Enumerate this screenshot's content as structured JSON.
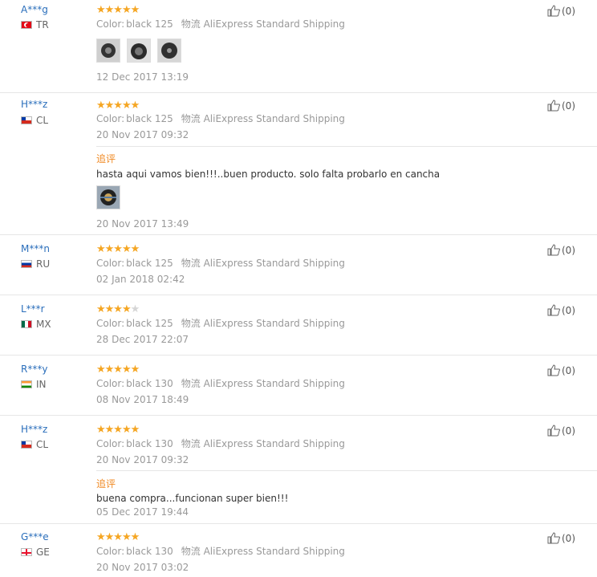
{
  "labels": {
    "color": "Color:",
    "shipping": "物流",
    "followup": "追评"
  },
  "stars_color": "#f5a623",
  "reviews": [
    {
      "user": "A***g",
      "country": "TR",
      "flag": "tr-flag-icon",
      "stars": 5,
      "color_value": "black 125",
      "shipping_value": "AliExpress Standard Shipping",
      "date": "12 Dec 2017 13:19",
      "likes": "(0)",
      "photos": 3
    },
    {
      "user": "H***z",
      "country": "CL",
      "flag": "cl-flag-icon",
      "stars": 5,
      "color_value": "black 125",
      "shipping_value": "AliExpress Standard Shipping",
      "date": "20 Nov 2017 09:32",
      "likes": "(0)",
      "followup": {
        "text": "hasta aqui vamos bien!!!..buen producto. solo falta probarlo en cancha",
        "date": "20 Nov 2017 13:49",
        "photos": 1
      }
    },
    {
      "user": "M***n",
      "country": "RU",
      "flag": "ru-flag-icon",
      "stars": 5,
      "color_value": "black 125",
      "shipping_value": "AliExpress Standard Shipping",
      "date": "02 Jan 2018 02:42",
      "likes": "(0)"
    },
    {
      "user": "L***r",
      "country": "MX",
      "flag": "mx-flag-icon",
      "stars": 4,
      "color_value": "black 125",
      "shipping_value": "AliExpress Standard Shipping",
      "date": "28 Dec 2017 22:07",
      "likes": "(0)"
    },
    {
      "user": "R***y",
      "country": "IN",
      "flag": "in-flag-icon",
      "stars": 5,
      "color_value": "black 130",
      "shipping_value": "AliExpress Standard Shipping",
      "date": "08 Nov 2017 18:49",
      "likes": "(0)"
    },
    {
      "user": "H***z",
      "country": "CL",
      "flag": "cl-flag-icon",
      "stars": 5,
      "color_value": "black 130",
      "shipping_value": "AliExpress Standard Shipping",
      "date": "20 Nov 2017 09:32",
      "likes": "(0)",
      "followup": {
        "text": "buena compra...funcionan super bien!!!",
        "date": "05 Dec 2017 19:44"
      }
    },
    {
      "user": "G***e",
      "country": "GE",
      "flag": "ge-flag-icon",
      "stars": 5,
      "color_value": "black 130",
      "shipping_value": "AliExpress Standard Shipping",
      "date": "20 Nov 2017 03:02",
      "likes": "(0)"
    }
  ]
}
